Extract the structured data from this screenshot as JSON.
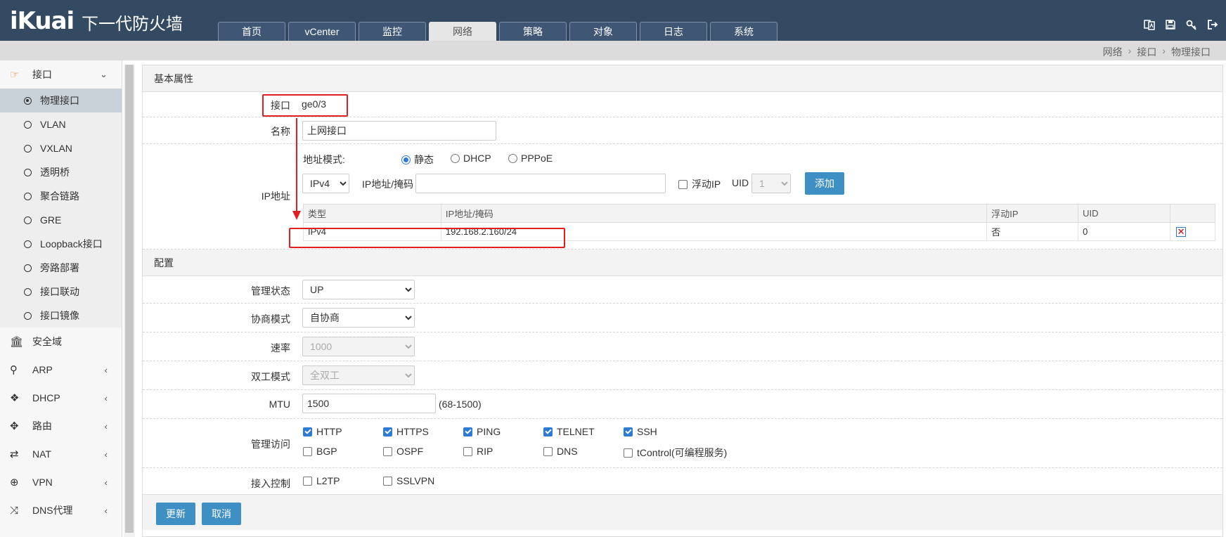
{
  "header": {
    "logo": "iKuai",
    "product": "下一代防火墙",
    "tabs": [
      "首页",
      "vCenter",
      "监控",
      "网络",
      "策略",
      "对象",
      "日志",
      "系统"
    ],
    "active_tab": "网络"
  },
  "breadcrumb": [
    "网络",
    "接口",
    "物理接口"
  ],
  "sidebar": {
    "interface_group": "接口",
    "items": [
      "物理接口",
      "VLAN",
      "VXLAN",
      "透明桥",
      "聚合链路",
      "GRE",
      "Loopback接口",
      "旁路部署",
      "接口联动",
      "接口镜像"
    ],
    "groups": [
      "安全域",
      "ARP",
      "DHCP",
      "路由",
      "NAT",
      "VPN",
      "DNS代理"
    ]
  },
  "basic": {
    "title": "基本属性",
    "interface_label": "接口",
    "interface_value": "ge0/3",
    "name_label": "名称",
    "name_value": "上网接口",
    "ip_label": "IP地址",
    "addr_mode_label": "地址模式:",
    "addr_modes": [
      "静态",
      "DHCP",
      "PPPoE"
    ],
    "ip_version": "IPv4",
    "ip_mask_label": "IP地址/掩码",
    "ip_mask_value": "",
    "float_ip_label": "浮动IP",
    "uid_label": "UID",
    "uid_value": "1",
    "add_button": "添加",
    "table_headers": [
      "类型",
      "IP地址/掩码",
      "浮动IP",
      "UID"
    ],
    "table_rows": [
      {
        "type": "IPv4",
        "ip": "192.168.2.160/24",
        "float": "否",
        "uid": "0"
      }
    ]
  },
  "config": {
    "title": "配置",
    "admin_state_label": "管理状态",
    "admin_state_value": "UP",
    "negotiation_label": "协商模式",
    "negotiation_value": "自协商",
    "speed_label": "速率",
    "speed_value": "1000",
    "duplex_label": "双工模式",
    "duplex_value": "全双工",
    "mtu_label": "MTU",
    "mtu_value": "1500",
    "mtu_range": "(68-1500)",
    "mgmt_label": "管理访问",
    "mgmt_row1": [
      "HTTP",
      "HTTPS",
      "PING",
      "TELNET",
      "SSH"
    ],
    "mgmt_row2": [
      "BGP",
      "OSPF",
      "RIP",
      "DNS",
      "tControl(可编程服务)"
    ],
    "access_label": "接入控制",
    "access_items": [
      "L2TP",
      "SSLVPN"
    ]
  },
  "footer": {
    "update_button": "更新",
    "cancel_button": "取消"
  },
  "colors": {
    "header_bg": "#344a63",
    "accent_blue": "#3d8fc4",
    "annotation_red": "#e02020",
    "active_icon": "#e98a35"
  }
}
